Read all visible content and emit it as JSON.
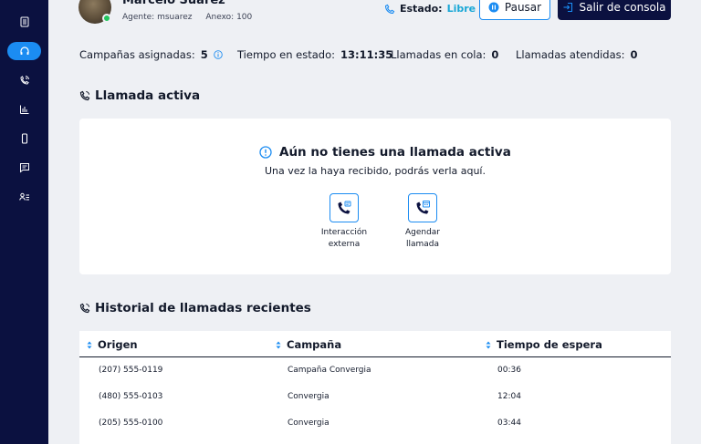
{
  "sidebar": {
    "items": [
      {
        "icon": "document-icon",
        "active": false
      },
      {
        "icon": "headset-icon",
        "active": true
      },
      {
        "icon": "phone-signal-icon",
        "active": false
      },
      {
        "icon": "bar-chart-icon",
        "active": false
      },
      {
        "icon": "mobile-icon",
        "active": false
      },
      {
        "icon": "message-icon",
        "active": false
      },
      {
        "icon": "user-list-icon",
        "active": false
      }
    ]
  },
  "agent": {
    "name": "Marcelo Suárez",
    "agent_label": "Agente: msuarez",
    "extension_label": "Anexo: 100"
  },
  "status": {
    "label": "Estado:",
    "value": "Libre",
    "value_color": "#19a7d6"
  },
  "buttons": {
    "pause": "Pausar",
    "exit": "Salir de consola"
  },
  "stats": {
    "campaigns_label": "Campañas asignadas:",
    "campaigns_value": "5",
    "time_label": "Tiempo en estado:",
    "time_value": "13:11:35",
    "queue_label": "Llamadas en cola:",
    "queue_value": "0",
    "attended_label": "Llamadas atendidas:",
    "attended_value": "0"
  },
  "active_call": {
    "title": "Llamada activa",
    "empty_title": "Aún no tienes una llamada activa",
    "empty_subtitle": "Una vez la haya recibido, podrás verla aquí.",
    "actions": [
      {
        "line1": "Interacción",
        "line2": "externa"
      },
      {
        "line1": "Agendar",
        "line2": "llamada"
      }
    ]
  },
  "history": {
    "title": "Historial de llamadas recientes",
    "columns": [
      "Origen",
      "Campaña",
      "Tiempo de espera"
    ],
    "rows": [
      [
        "(207) 555-0119",
        "Campaña Convergia",
        "00:36"
      ],
      [
        "(480) 555-0103",
        "Convergia",
        "12:04"
      ],
      [
        "(205) 555-0100",
        "Convergia",
        "03:44"
      ]
    ]
  },
  "colors": {
    "sidebar": "#0b1140",
    "accent": "#1b8cf2",
    "online": "#23c55e"
  }
}
